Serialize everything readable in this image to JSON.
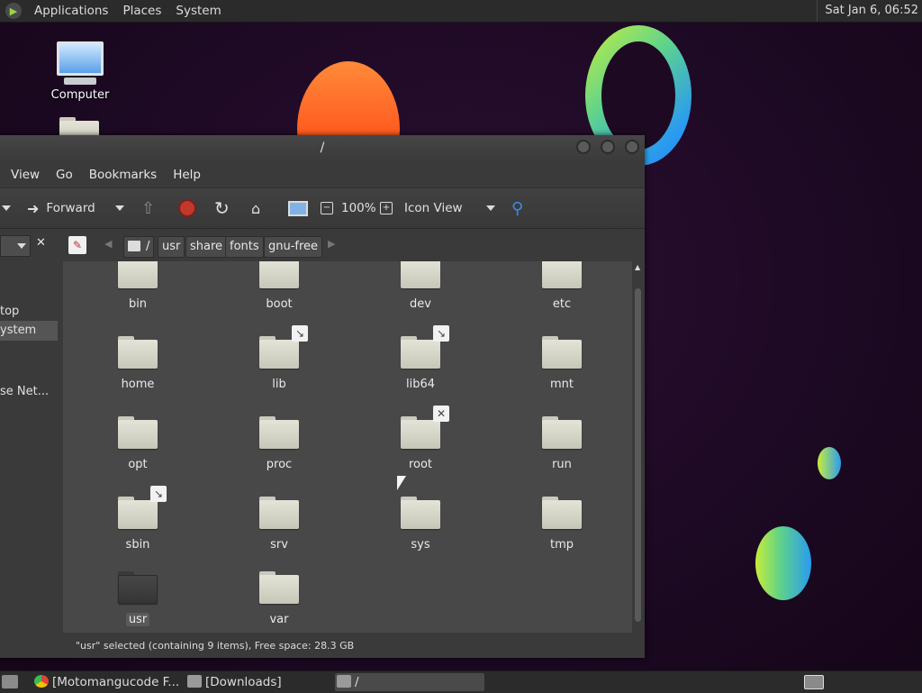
{
  "top_panel": {
    "menus": [
      "Applications",
      "Places",
      "System"
    ],
    "clock": "Sat Jan  6, 06:52"
  },
  "desktop": {
    "icons": [
      {
        "label": "Computer"
      }
    ]
  },
  "window": {
    "title": "/",
    "menubar": [
      "View",
      "Go",
      "Bookmarks",
      "Help"
    ],
    "toolbar": {
      "forward_label": "Forward",
      "zoom": "100%",
      "view_mode": "Icon View"
    },
    "breadcrumb": [
      "/",
      "usr",
      "share",
      "fonts",
      "gnu-free"
    ],
    "sidebar": [
      "top",
      "ystem",
      "se Net..."
    ],
    "folders": [
      {
        "name": "bin",
        "emblem": "link-emblem"
      },
      {
        "name": "boot"
      },
      {
        "name": "dev"
      },
      {
        "name": "etc"
      },
      {
        "name": "home"
      },
      {
        "name": "lib",
        "emblem": "link-emblem"
      },
      {
        "name": "lib64",
        "emblem": "link-emblem"
      },
      {
        "name": "mnt"
      },
      {
        "name": "opt"
      },
      {
        "name": "proc"
      },
      {
        "name": "root",
        "emblem": "no-access-emblem"
      },
      {
        "name": "run"
      },
      {
        "name": "sbin",
        "emblem": "link-emblem"
      },
      {
        "name": "srv"
      },
      {
        "name": "sys"
      },
      {
        "name": "tmp"
      },
      {
        "name": "usr",
        "selected": true
      },
      {
        "name": "var"
      }
    ],
    "status": "\"usr\" selected (containing 9 items), Free space: 28.3 GB"
  },
  "taskbar": {
    "items": [
      {
        "label": "[Motomangucode F..."
      },
      {
        "label": "[Downloads]"
      },
      {
        "label": "/",
        "active": true
      }
    ]
  },
  "colors": {
    "panel": "#2b2b2b",
    "window_bg": "#3a3a3a",
    "content_bg": "#484848",
    "folder": "#d8d8cb",
    "stop_red": "#c0392b",
    "search_blue": "#3a8ee6"
  }
}
